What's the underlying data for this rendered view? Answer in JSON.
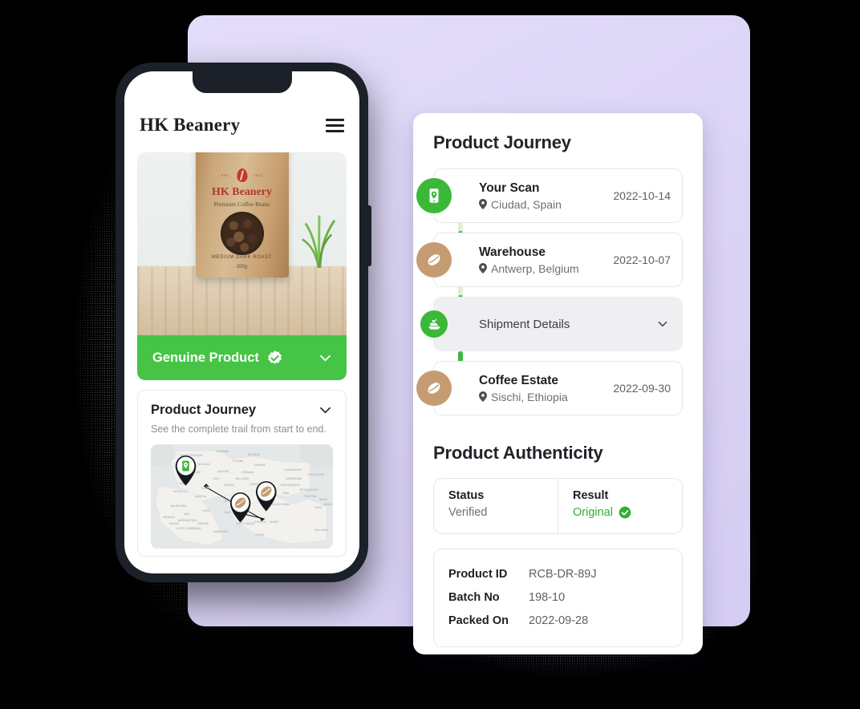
{
  "theme": {
    "accent_green": "#3CB839",
    "bright_green": "#45C445",
    "tan": "#C59C72",
    "lavender": "#DCD5F6",
    "phone_frame": "#1B2029"
  },
  "phone": {
    "brand": "HK Beanery",
    "menu_icon": "hamburger-menu-icon",
    "product_image": {
      "brand_on_bag": "HK Beanery",
      "tagline_on_bag": "Premium Coffee Beans",
      "roast": "MEDIUM DARK ROAST",
      "weight": "200g",
      "left_tick": "EST.",
      "right_tick": "1932"
    },
    "genuine_bar": {
      "label": "Genuine Product",
      "verified_icon": "verified-check-icon",
      "expand_icon": "chevron-down-icon"
    },
    "journey_card": {
      "title": "Product Journey",
      "subtitle": "See the complete trail from start to end.",
      "expand_icon": "chevron-down-icon",
      "map_labels": [
        "UNITED KINGDOM",
        "DENMARK",
        "BELARUS",
        "POLAND",
        "UKRAINE",
        "BELGIUM",
        "FRANCE",
        "AUSTRIA",
        "ROMANIA",
        "ITALY",
        "BULGARIA",
        "GREECE",
        "TURKEY",
        "KAZAKHSTAN",
        "UZBEKISTAN",
        "KYRGYZSTAN",
        "TURKMENISTAN",
        "AFGHANISTAN",
        "PAKISTAN",
        "NEPAL",
        "INDIA",
        "BANGLADESH",
        "SYRIA",
        "IRAQ",
        "IRAN",
        "SAUDI ARABIA",
        "YEMEN",
        "EGYPT",
        "LIBYA",
        "ALGERIA",
        "MOROCCO",
        "TUNISIA",
        "MAURITANIA",
        "MALI",
        "NIGER",
        "CHAD",
        "SUDAN",
        "SOUTH SUDAN",
        "ETHIOPIA",
        "KENYA",
        "NIGERIA",
        "CAMEROON",
        "SENEGAL",
        "GUINEA",
        "BURKINA FASO",
        "IVORY COAST",
        "GHANA",
        "SPAIN",
        "SRI LANKA"
      ],
      "pins": [
        {
          "icon": "scan-phone-pin-icon",
          "place": "Spain"
        },
        {
          "icon": "coffee-bean-pin-icon",
          "place": "Ethiopia"
        },
        {
          "icon": "coffee-bean-pin-icon",
          "place": "Yemen"
        }
      ]
    }
  },
  "panel": {
    "journey": {
      "title": "Product Journey",
      "steps": [
        {
          "name": "Your Scan",
          "location": "Ciudad, Spain",
          "date": "2022-10-14",
          "icon": "scan-phone-icon",
          "badge_color": "green",
          "type": "stop"
        },
        {
          "name": "Warehouse",
          "location": "Antwerp, Belgium",
          "date": "2022-10-07",
          "icon": "coffee-bean-icon",
          "badge_color": "tan",
          "type": "stop"
        },
        {
          "name": "Shipment Details",
          "icon": "ship-icon",
          "badge_color": "green",
          "type": "expandable",
          "expand_icon": "chevron-down-icon"
        },
        {
          "name": "Coffee Estate",
          "location": "Sischi, Ethiopia",
          "date": "2022-09-30",
          "icon": "coffee-bean-icon",
          "badge_color": "tan",
          "type": "stop"
        }
      ]
    },
    "authenticity": {
      "title": "Product Authenticity",
      "status_label": "Status",
      "status_value": "Verified",
      "result_label": "Result",
      "result_value": "Original",
      "result_icon": "verified-check-icon",
      "details": [
        {
          "key": "Product ID",
          "value": "RCB-DR-89J"
        },
        {
          "key": "Batch No",
          "value": "198-10"
        },
        {
          "key": "Packed On",
          "value": "2022-09-28"
        }
      ]
    }
  }
}
